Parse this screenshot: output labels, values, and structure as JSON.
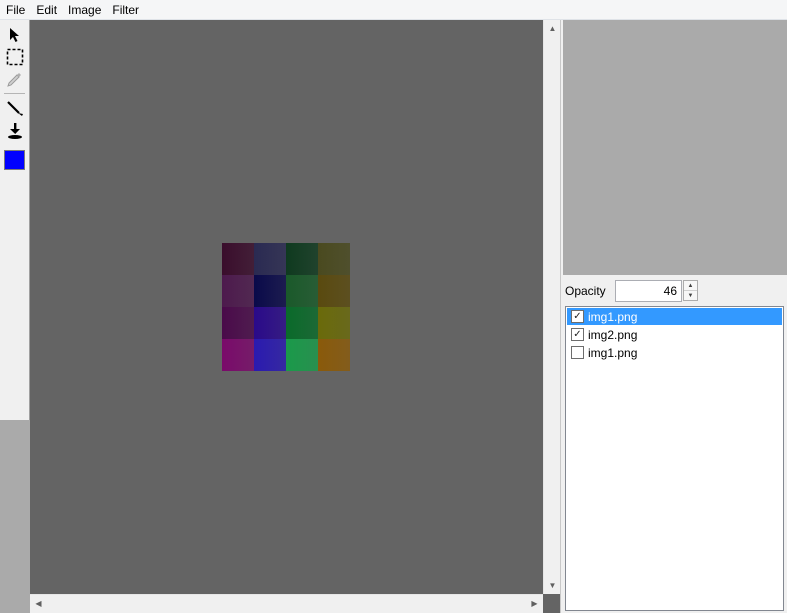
{
  "menubar": {
    "items": [
      "File",
      "Edit",
      "Image",
      "Filter"
    ]
  },
  "toolbox": {
    "tools": [
      "pointer-icon",
      "marquee-select-icon",
      "eyedropper-icon",
      "line-icon",
      "fill-bucket-icon"
    ],
    "current_color": "#0000ff"
  },
  "canvas": {
    "background": "#646464",
    "tile_colors": [
      [
        "#3a0d2c",
        "#2a2a52",
        "#0f3a1f",
        "#4a4a1f"
      ],
      [
        "#4d1a4d",
        "#0a0a4a",
        "#1a5a2a",
        "#5a4a0f"
      ],
      [
        "#4a0a4a",
        "#2a0a8a",
        "#0a6a2a",
        "#6a6a0a"
      ],
      [
        "#7a0a6a",
        "#2a1ab0",
        "#1a9a4a",
        "#8a5a0a"
      ]
    ]
  },
  "panel": {
    "opacity_label": "Opacity",
    "opacity_value": "46",
    "layers": [
      {
        "name": "img1.png",
        "checked": true,
        "selected": true
      },
      {
        "name": "img2.png",
        "checked": true,
        "selected": false
      },
      {
        "name": "img1.png",
        "checked": false,
        "selected": false
      }
    ]
  }
}
